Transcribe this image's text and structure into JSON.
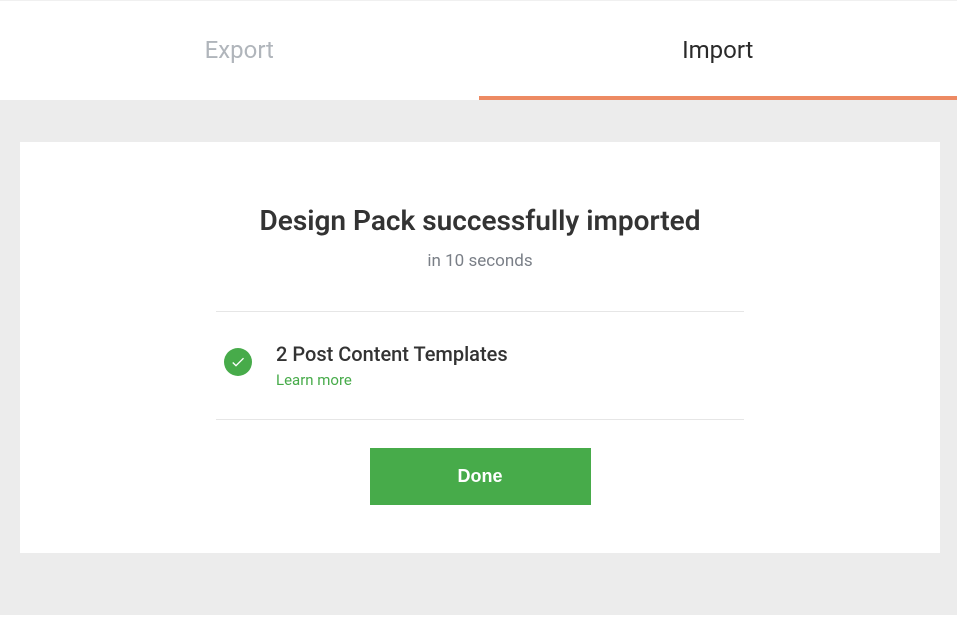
{
  "tabs": {
    "export": "Export",
    "import": "Import"
  },
  "card": {
    "title": "Design Pack successfully imported",
    "subtitle": "in 10 seconds",
    "item_title": "2 Post Content Templates",
    "learn_more": "Learn more",
    "done": "Done"
  }
}
